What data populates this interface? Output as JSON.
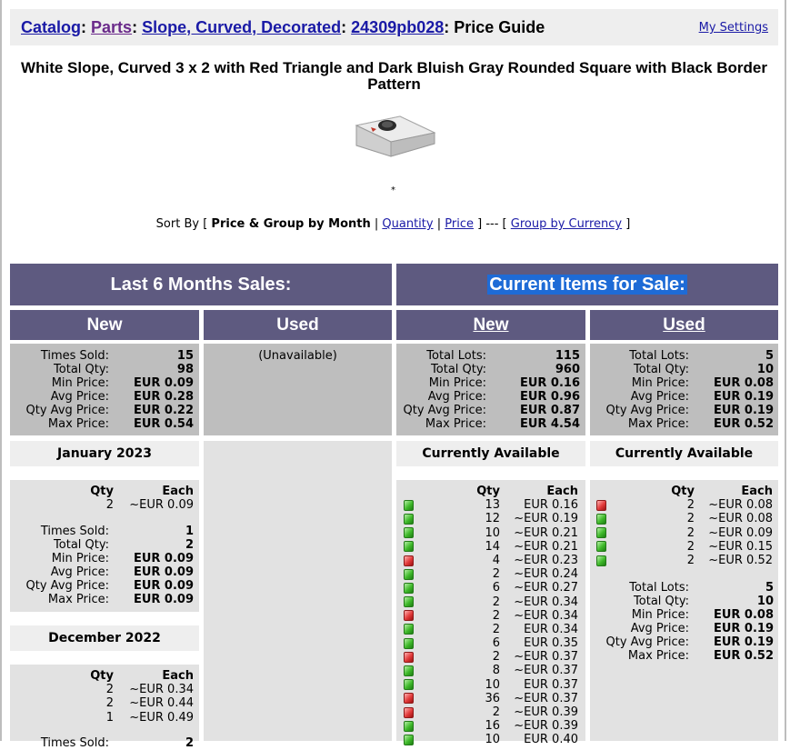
{
  "breadcrumb": {
    "catalog": "Catalog",
    "parts": "Parts",
    "category": "Slope, Curved, Decorated",
    "item": "24309pb028",
    "page": "Price Guide",
    "sep": ":"
  },
  "my_settings": "My Settings",
  "title": "White Slope, Curved 3 x 2 with Red Triangle and Dark Bluish Gray Rounded Square with Black Border Pattern",
  "asterisk": "*",
  "sort": {
    "prefix": "Sort By [",
    "active": "Price & Group by Month",
    "sep1": "|",
    "quantity": "Quantity",
    "sep2": "|",
    "price": "Price",
    "mid": "] --- [",
    "group_currency": "Group by Currency",
    "suffix": "]"
  },
  "headers": {
    "last6": "Last 6 Months Sales:",
    "current": "Current Items for Sale:",
    "new": "New",
    "used": "Used",
    "cur_new": "New",
    "cur_used": "Used"
  },
  "last6_new_summary": [
    {
      "label": "Times Sold:",
      "value": "15"
    },
    {
      "label": "Total Qty:",
      "value": "98"
    },
    {
      "label": "Min Price:",
      "value": "EUR 0.09"
    },
    {
      "label": "Avg Price:",
      "value": "EUR 0.28"
    },
    {
      "label": "Qty Avg Price:",
      "value": "EUR 0.22"
    },
    {
      "label": "Max Price:",
      "value": "EUR 0.54"
    }
  ],
  "last6_used_summary": "(Unavailable)",
  "cur_new_summary": [
    {
      "label": "Total Lots:",
      "value": "115"
    },
    {
      "label": "Total Qty:",
      "value": "960"
    },
    {
      "label": "Min Price:",
      "value": "EUR 0.16"
    },
    {
      "label": "Avg Price:",
      "value": "EUR 0.96"
    },
    {
      "label": "Qty Avg Price:",
      "value": "EUR 0.87"
    },
    {
      "label": "Max Price:",
      "value": "EUR 4.54"
    }
  ],
  "cur_used_summary": [
    {
      "label": "Total Lots:",
      "value": "5"
    },
    {
      "label": "Total Qty:",
      "value": "10"
    },
    {
      "label": "Min Price:",
      "value": "EUR 0.08"
    },
    {
      "label": "Avg Price:",
      "value": "EUR 0.19"
    },
    {
      "label": "Qty Avg Price:",
      "value": "EUR 0.19"
    },
    {
      "label": "Max Price:",
      "value": "EUR 0.52"
    }
  ],
  "col_qty": "Qty",
  "col_each": "Each",
  "currently_available": "Currently Available",
  "jan": {
    "month": "January 2023",
    "rows": [
      {
        "qty": "2",
        "each": "~EUR 0.09"
      }
    ],
    "summary": [
      {
        "label": "Times Sold:",
        "value": "1"
      },
      {
        "label": "Total Qty:",
        "value": "2"
      },
      {
        "label": "Min Price:",
        "value": "EUR 0.09"
      },
      {
        "label": "Avg Price:",
        "value": "EUR 0.09"
      },
      {
        "label": "Qty Avg Price:",
        "value": "EUR 0.09"
      },
      {
        "label": "Max Price:",
        "value": "EUR 0.09"
      }
    ]
  },
  "dec": {
    "month": "December 2022",
    "rows": [
      {
        "qty": "2",
        "each": "~EUR 0.34"
      },
      {
        "qty": "2",
        "each": "~EUR 0.44"
      },
      {
        "qty": "1",
        "each": "~EUR 0.49"
      }
    ],
    "partial_label": "Times Sold:",
    "partial_value": "2"
  },
  "cur_new_rows": [
    {
      "flag": "green",
      "qty": "13",
      "each": "EUR 0.16"
    },
    {
      "flag": "green",
      "qty": "12",
      "each": "~EUR 0.19"
    },
    {
      "flag": "green",
      "qty": "10",
      "each": "~EUR 0.21"
    },
    {
      "flag": "green",
      "qty": "14",
      "each": "~EUR 0.21"
    },
    {
      "flag": "red",
      "qty": "4",
      "each": "~EUR 0.23"
    },
    {
      "flag": "green",
      "qty": "2",
      "each": "~EUR 0.24"
    },
    {
      "flag": "green",
      "qty": "6",
      "each": "~EUR 0.27"
    },
    {
      "flag": "green",
      "qty": "2",
      "each": "~EUR 0.34"
    },
    {
      "flag": "red",
      "qty": "2",
      "each": "~EUR 0.34"
    },
    {
      "flag": "green",
      "qty": "2",
      "each": "EUR 0.34"
    },
    {
      "flag": "green",
      "qty": "6",
      "each": "EUR 0.35"
    },
    {
      "flag": "red",
      "qty": "2",
      "each": "~EUR 0.37"
    },
    {
      "flag": "green",
      "qty": "8",
      "each": "~EUR 0.37"
    },
    {
      "flag": "green",
      "qty": "10",
      "each": "EUR 0.37"
    },
    {
      "flag": "red",
      "qty": "36",
      "each": "~EUR 0.37"
    },
    {
      "flag": "red",
      "qty": "2",
      "each": "~EUR 0.39"
    },
    {
      "flag": "green",
      "qty": "16",
      "each": "~EUR 0.39"
    },
    {
      "flag": "green",
      "qty": "10",
      "each": "EUR 0.40"
    }
  ],
  "cur_used_rows": [
    {
      "flag": "red",
      "qty": "2",
      "each": "~EUR 0.08"
    },
    {
      "flag": "green",
      "qty": "2",
      "each": "~EUR 0.08"
    },
    {
      "flag": "green",
      "qty": "2",
      "each": "~EUR 0.09"
    },
    {
      "flag": "green",
      "qty": "2",
      "each": "~EUR 0.15"
    },
    {
      "flag": "green",
      "qty": "2",
      "each": "~EUR 0.52"
    }
  ]
}
